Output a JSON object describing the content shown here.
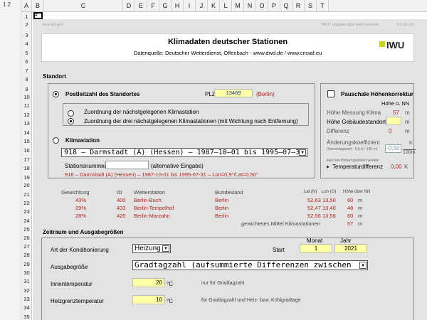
{
  "outline": {
    "levels": "1 2"
  },
  "columns": [
    "A",
    "B",
    "C",
    "D",
    "E",
    "F",
    "G",
    "H",
    "I",
    "J",
    "K",
    "L",
    "M",
    "N",
    "O",
    "P",
    "Q",
    "R",
    "S",
    "T"
  ],
  "rows": [
    "1",
    "2",
    "3",
    "4",
    "5",
    "6",
    "7",
    "8",
    "9",
    "10",
    "11",
    "12",
    "13",
    "14",
    "15",
    "16",
    "17",
    "18",
    "19",
    "20",
    "21",
    "22",
    "23",
    "24",
    "25",
    "26",
    "27",
    "28",
    "29",
    "30",
    "31",
    "32",
    "33",
    "34",
    "35"
  ],
  "cell_a1": "#",
  "header": {
    "tool_name": "iwu.xl.tool",
    "version_label": "IWU climate data tool version:",
    "version_date": "03.02.22"
  },
  "banner": {
    "title": "Klimadaten deutscher Stationen",
    "subtitle": "Datenquelle: Deutscher Wetterdienst, Offenbach - www.dwd.de / www.cmsaf.eu",
    "logo_text": "IWU"
  },
  "standort": {
    "section_label": "Standort",
    "plz_option_label": "Postleitzahl des Standortes",
    "plz_label": "PLZ",
    "plz_value": "13469",
    "plz_city": "(Berlin)",
    "sub_option1": "Zuordnung der nächstgelegenen Klimastation",
    "sub_option2": "Zuordnung der drei nächstgelegenen Klimastationen (mit Wichtung nach Entfernung)",
    "station_option_label": "Klimastation",
    "station_dropdown": "918  –  Darmstadt (A) (Hessen)  –  1987–10–01 bis 1995–07–31",
    "station_number_label": "Stationsnummer:",
    "station_number_value": "",
    "station_number_hint": "(alternative Eingabe)",
    "station_info": "918  –  Darmstadt (A) (Hessen)  –  1987-10-01 bis 1995-07-31  –  Lon=0,9°/Lat=0,50°"
  },
  "hoehe": {
    "title": "Pauschale Höhenkorrektur",
    "col_header": "Höhe ü. NN",
    "rows": [
      {
        "label": "Höhe Messung Klima",
        "value": "57",
        "unit": "m"
      },
      {
        "label": "Höhe Gebäudestandort",
        "value": "",
        "unit": "m"
      },
      {
        "label": "Differenz",
        "value": "0",
        "unit": "m"
      }
    ],
    "coef_label": "Änderungskoeffizient",
    "coef_unit_top": "K",
    "coef_hint": "(Vorschlagswert - 0,5 K / 100 m)",
    "coef_value": "-0,50",
    "coef_unit": "100m",
    "coef_note": "kann bei Bedarf geändert werden",
    "temp_label": "Temperaturdifferenz",
    "temp_value": "0,00",
    "temp_unit": "K"
  },
  "stations_table": {
    "headers": [
      "Gewichtung",
      "ID",
      "Wetterstation",
      "Bundesland",
      "Lat (N)",
      "Lon (O)",
      "Höhe über NN"
    ],
    "rows": [
      [
        "43%",
        "400",
        "Berlin-Buch",
        "Berlin",
        "52,63",
        "13,50",
        "60",
        "m"
      ],
      [
        "29%",
        "433",
        "Berlin-Tempelhof",
        "Berlin",
        "52,47",
        "13,40",
        "48",
        "m"
      ],
      [
        "28%",
        "420",
        "Berlin-Marzahn",
        "Berlin",
        "52,56",
        "13,56",
        "60",
        "m"
      ]
    ],
    "weighted_label": "gewichtetes Mittel Klimastationen",
    "weighted_value": "57",
    "weighted_unit": "m"
  },
  "zeitraum": {
    "section_label": "Zeitraum und Ausgabegrößen",
    "konditionierung_label": "Art der Konditionierung",
    "konditionierung_value": "Heizung",
    "start_label": "Start",
    "monat_label": "Monat",
    "jahr_label": "Jahr",
    "monat_value": "1",
    "jahr_value": "2021",
    "ausgabe_label": "Ausgabegröße",
    "ausgabe_value": "Gradtagzahl (aufsummierte Differenzen zwischen",
    "innen_label": "Innentemperatur",
    "innen_value": "20",
    "innen_unit": "°C",
    "innen_hint": "nur für Gradtagzahl",
    "heizgrenz_label": "Heizgrenztemperatur",
    "heizgrenz_value": "10",
    "heizgrenz_unit": "°C",
    "heizgrenz_hint": "für Gradtagzahl und Heiz- bzw. Kühlgradtage"
  }
}
